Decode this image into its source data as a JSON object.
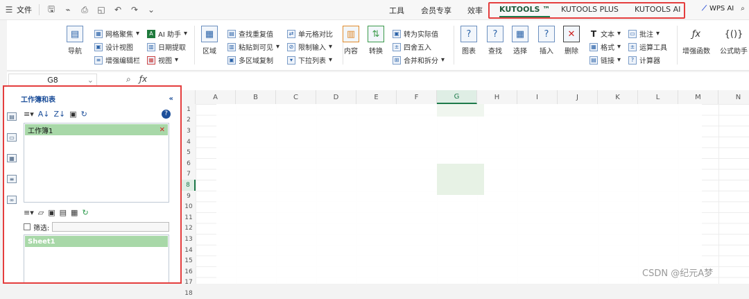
{
  "quick_access": {
    "file_label": "文件"
  },
  "tabs": [
    {
      "label": "工具"
    },
    {
      "label": "会员专享"
    },
    {
      "label": "效率"
    },
    {
      "label": "KUTOOLS ™"
    },
    {
      "label": "KUTOOLS PLUS"
    },
    {
      "label": "KUTOOLS AI"
    }
  ],
  "wps_ai": {
    "label": "WPS AI"
  },
  "ribbon": {
    "navigate": "导航",
    "grid_focus": "网格聚焦",
    "design_view": "设计视图",
    "enhanced_edit_bar": "增强编辑栏",
    "ai_assistant": "AI 助手",
    "date_extract": "日期提取",
    "view": "视图",
    "region": "区域",
    "find_duplicates": "查找重复值",
    "paste_visible": "粘贴到可见",
    "multi_region_copy": "多区域复制",
    "cell_compare": "单元格对比",
    "restrict_input": "限制输入",
    "dropdown_list": "下拉列表",
    "content": "内容",
    "convert": "转换",
    "to_actual": "转为实际值",
    "round": "四舍五入",
    "merge_split": "合并和拆分",
    "chart": "图表",
    "find": "查找",
    "select": "选择",
    "insert": "插入",
    "delete": "删除",
    "text": "文本",
    "format": "格式",
    "link": "链接",
    "comment": "批注",
    "calc_tools": "运算工具",
    "calculator": "计算器",
    "enhanced_functions": "增强函数",
    "formula_helper": "公式助手"
  },
  "formula_bar": {
    "cell_ref": "G8"
  },
  "panel": {
    "title": "工作簿和表",
    "workbooks": [
      "工作簿1"
    ],
    "filter_label": "筛选:",
    "sheets": [
      "Sheet1"
    ]
  },
  "sheet": {
    "columns": [
      "A",
      "B",
      "C",
      "D",
      "E",
      "F",
      "G",
      "H",
      "I",
      "J",
      "K",
      "L",
      "M",
      "N"
    ],
    "rows": [
      "1",
      "2",
      "3",
      "4",
      "5",
      "6",
      "7",
      "8",
      "9",
      "10",
      "11",
      "12",
      "13",
      "14",
      "15",
      "16",
      "17",
      "18"
    ],
    "selected_column": "G",
    "selected_row": "8"
  },
  "watermark": "CSDN @纪元A梦"
}
